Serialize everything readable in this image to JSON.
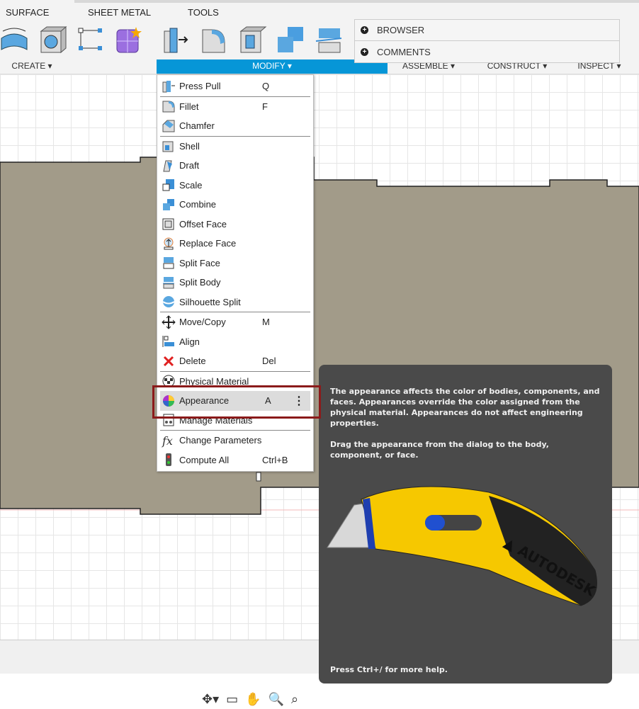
{
  "toolbar": {
    "tabs": [
      "SURFACE",
      "SHEET METAL",
      "TOOLS"
    ],
    "groups": {
      "create": "CREATE ▾",
      "modify": "MODIFY ▾",
      "assemble": "ASSEMBLE ▾",
      "construct": "CONSTRUCT ▾",
      "inspect": "INSPECT ▾"
    },
    "accent": "#0696d7"
  },
  "panel": {
    "items": [
      "BROWSER",
      "COMMENTS"
    ]
  },
  "menu": {
    "items": [
      {
        "label": "Press Pull",
        "shortcut": "Q",
        "icon": "press-pull-icon"
      },
      {
        "label": "Fillet",
        "shortcut": "F",
        "icon": "fillet-icon"
      },
      {
        "label": "Chamfer",
        "shortcut": "",
        "icon": "chamfer-icon"
      },
      {
        "label": "Shell",
        "shortcut": "",
        "icon": "shell-icon"
      },
      {
        "label": "Draft",
        "shortcut": "",
        "icon": "draft-icon"
      },
      {
        "label": "Scale",
        "shortcut": "",
        "icon": "scale-icon"
      },
      {
        "label": "Combine",
        "shortcut": "",
        "icon": "combine-icon"
      },
      {
        "label": "Offset Face",
        "shortcut": "",
        "icon": "offset-face-icon"
      },
      {
        "label": "Replace Face",
        "shortcut": "",
        "icon": "replace-face-icon"
      },
      {
        "label": "Split Face",
        "shortcut": "",
        "icon": "split-face-icon"
      },
      {
        "label": "Split Body",
        "shortcut": "",
        "icon": "split-body-icon"
      },
      {
        "label": "Silhouette Split",
        "shortcut": "",
        "icon": "silhouette-split-icon"
      },
      {
        "label": "Move/Copy",
        "shortcut": "M",
        "icon": "move-icon"
      },
      {
        "label": "Align",
        "shortcut": "",
        "icon": "align-icon"
      },
      {
        "label": "Delete",
        "shortcut": "Del",
        "icon": "delete-icon"
      },
      {
        "label": "Physical Material",
        "shortcut": "",
        "icon": "physical-material-icon"
      },
      {
        "label": "Appearance",
        "shortcut": "A",
        "icon": "appearance-icon"
      },
      {
        "label": "Manage Materials",
        "shortcut": "",
        "icon": "manage-materials-icon"
      },
      {
        "label": "Change Parameters",
        "shortcut": "",
        "icon": "fx-icon"
      },
      {
        "label": "Compute All",
        "shortcut": "Ctrl+B",
        "icon": "compute-all-icon"
      }
    ],
    "highlighted": "Appearance",
    "more": "⋮"
  },
  "tooltip": {
    "p1": "The appearance affects the color of bodies, components, and faces. Appearances override the color assigned from the physical material. Appearances do not affect engineering properties.",
    "p2": "Drag the appearance from the dialog to the body, component, or face.",
    "help": "Press Ctrl+/ for more help.",
    "logo": "AUTODESK"
  },
  "nav": {
    "icons": [
      "orbit-icon",
      "look-at-icon",
      "pan-icon",
      "zoom-icon",
      "fit-icon"
    ]
  }
}
